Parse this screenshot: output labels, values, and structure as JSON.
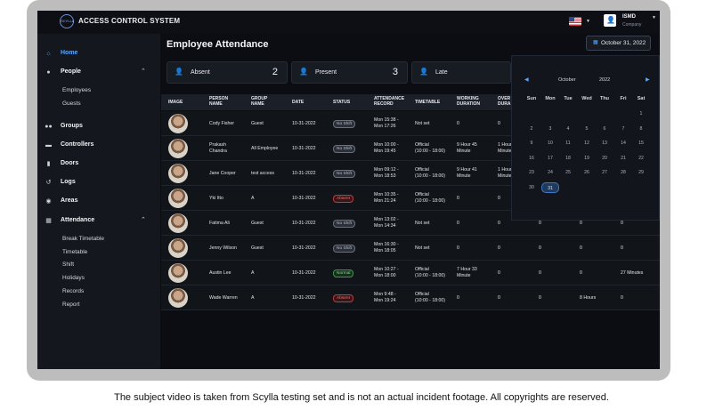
{
  "app": {
    "title": "ACCESS CONTROL SYSTEM",
    "logo_text": "SCYLLA"
  },
  "user": {
    "name": "ISMD",
    "role": "Company"
  },
  "sidebar": {
    "items": [
      {
        "label": "Home",
        "icon": "home-icon"
      },
      {
        "label": "People",
        "icon": "person-icon",
        "sub": [
          "Employees",
          "Guests"
        ]
      },
      {
        "label": "Groups",
        "icon": "group-icon"
      },
      {
        "label": "Controllers",
        "icon": "controller-icon"
      },
      {
        "label": "Doors",
        "icon": "door-icon"
      },
      {
        "label": "Logs",
        "icon": "history-icon"
      },
      {
        "label": "Areas",
        "icon": "location-icon"
      },
      {
        "label": "Attendance",
        "icon": "calendar-icon",
        "sub": [
          "Break Timetable",
          "Timetable",
          "Shift",
          "Holidays",
          "Records",
          "Report"
        ]
      }
    ]
  },
  "page": {
    "title": "Employee Attendance",
    "date": "October 31, 2022"
  },
  "stats": [
    {
      "label": "Absent",
      "count": "2",
      "color": "#ff6b6b"
    },
    {
      "label": "Present",
      "count": "3",
      "color": "#58a6ff"
    },
    {
      "label": "Late",
      "count": "",
      "color": "#f0a04b"
    }
  ],
  "table": {
    "headers": [
      "IMAGE",
      "PERSON NAME",
      "GROUP NAME",
      "DATE",
      "STATUS",
      "ATTENDANCE RECORD",
      "TIMETABLE",
      "WORKING DURATION",
      "OVER DURA"
    ],
    "rows": [
      {
        "name": "Cody Fisher",
        "group": "Guest",
        "date": "10-31-2022",
        "status": "No Shift",
        "status_type": "noshift",
        "record": "Mon 15:38 -\nMon 17:26",
        "timetable": "Not set",
        "working": "0",
        "overtime": "0",
        "c9": "",
        "c10": "",
        "c11": ""
      },
      {
        "name": "Prakash\nChandra",
        "group": "All Employee",
        "date": "10-31-2022",
        "status": "No Shift",
        "status_type": "noshift",
        "record": "Mon 10:00 -\nMon 19:45",
        "timetable": "Official\n(10:00 - 18:00)",
        "working": "9 Hour 45\nMinute",
        "overtime": "1 Hour\nMinute",
        "c9": "",
        "c10": "",
        "c11": ""
      },
      {
        "name": "Jane Cooper",
        "group": "test access",
        "date": "10-31-2022",
        "status": "No Shift",
        "status_type": "noshift",
        "record": "Mon 09:12 -\nMon 18:53",
        "timetable": "Official\n(10:00 - 18:00)",
        "working": "9 Hour 41\nMinute",
        "overtime": "1 Hour\nMinute",
        "c9": "",
        "c10": "",
        "c11": ""
      },
      {
        "name": "Yki Itto",
        "group": "A",
        "date": "10-31-2022",
        "status": "Absent",
        "status_type": "absent",
        "record": "Mon 10:35 -\nMon 21:24",
        "timetable": "Official\n(10:00 - 18:00)",
        "working": "0",
        "overtime": "0",
        "c9": "",
        "c10": "",
        "c11": ""
      },
      {
        "name": "Fatima Ali",
        "group": "Guest",
        "date": "10-31-2022",
        "status": "No Shift",
        "status_type": "noshift",
        "record": "Mon 13:02 -\nMon 14:34",
        "timetable": "Not set",
        "working": "0",
        "overtime": "0",
        "c9": "0",
        "c10": "0",
        "c11": "0"
      },
      {
        "name": "Jenny Wilson",
        "group": "Guest",
        "date": "10-31-2022",
        "status": "No Shift",
        "status_type": "noshift",
        "record": "Mon 16:30 -\nMon 18:05",
        "timetable": "Not set",
        "working": "0",
        "overtime": "0",
        "c9": "0",
        "c10": "0",
        "c11": "0"
      },
      {
        "name": "Austin Lee",
        "group": "A",
        "date": "10-31-2022",
        "status": "Normal",
        "status_type": "normal",
        "record": "Mon 10:27 -\nMon 18:00",
        "timetable": "Official\n(10:00 - 18:00)",
        "working": "7 Hour 33\nMinute",
        "overtime": "0",
        "c9": "0",
        "c10": "0",
        "c11": "27 Minutes"
      },
      {
        "name": "Wade Warren",
        "group": "A",
        "date": "10-31-2022",
        "status": "Absent",
        "status_type": "absent",
        "record": "Mon 9:48 -\nMon 19:24",
        "timetable": "Official\n(10:00 - 18:00)",
        "working": "0",
        "overtime": "0",
        "c9": "0",
        "c10": "8 Hours",
        "c11": "0"
      }
    ]
  },
  "calendar": {
    "month": "October",
    "year": "2022",
    "day_names": [
      "Sun",
      "Mon",
      "Tue",
      "Wed",
      "Thu",
      "Fri",
      "Sat"
    ],
    "weeks": [
      [
        "",
        "",
        "",
        "",
        "",
        "",
        "1"
      ],
      [
        "2",
        "3",
        "4",
        "5",
        "6",
        "7",
        "8"
      ],
      [
        "9",
        "10",
        "11",
        "12",
        "13",
        "14",
        "15"
      ],
      [
        "16",
        "17",
        "18",
        "19",
        "20",
        "21",
        "22"
      ],
      [
        "23",
        "24",
        "25",
        "26",
        "27",
        "28",
        "29"
      ],
      [
        "30",
        "31",
        "",
        "",
        "",
        "",
        ""
      ]
    ],
    "selected": "31"
  },
  "footer": "The subject video is taken from Scylla testing set and is not an actual incident footage. All copyrights are reserved."
}
